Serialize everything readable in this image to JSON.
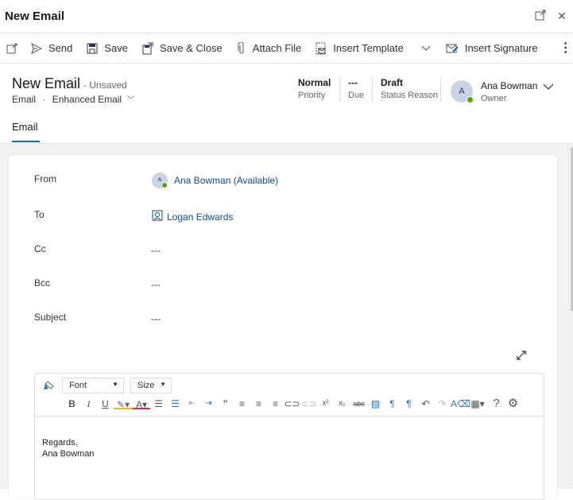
{
  "window": {
    "title": "New Email",
    "popout_icon": "popout-icon",
    "close_icon": "close-icon"
  },
  "commands": [
    {
      "label": "",
      "icon": "open-new-window-icon"
    },
    {
      "label": "Send",
      "icon": "send-icon"
    },
    {
      "label": "Save",
      "icon": "save-icon"
    },
    {
      "label": "Save & Close",
      "icon": "save-close-icon"
    },
    {
      "label": "Attach File",
      "icon": "attach-icon"
    },
    {
      "label": "Insert Template",
      "icon": "template-icon"
    },
    {
      "label": "Insert Signature",
      "icon": "signature-icon"
    }
  ],
  "header": {
    "title": "New Email",
    "status": "- Unsaved",
    "entity": "Email",
    "form": "Enhanced Email",
    "fields": [
      {
        "value": "Normal",
        "label": "Priority"
      },
      {
        "value": "---",
        "label": "Due"
      },
      {
        "value": "Draft",
        "label": "Status Reason"
      }
    ],
    "owner": {
      "initial": "A",
      "name": "Ana Bowman",
      "label": "Owner",
      "presence_color": "#57a300"
    }
  },
  "tabs": [
    {
      "label": "Email",
      "active": true
    }
  ],
  "form": {
    "from": {
      "label": "From",
      "initial": "A",
      "value": "Ana Bowman (Available)"
    },
    "to": {
      "label": "To",
      "value": "Logan Edwards"
    },
    "cc": {
      "label": "Cc",
      "value": "---"
    },
    "bcc": {
      "label": "Bcc",
      "value": "---"
    },
    "subject": {
      "label": "Subject",
      "value": "---"
    }
  },
  "editor": {
    "font_label": "Font",
    "size_label": "Size",
    "body_line1": "Regards,",
    "body_line2": "Ana Bowman"
  },
  "colors": {
    "accent": "#0f6cbd",
    "link": "#0f4a9e"
  }
}
